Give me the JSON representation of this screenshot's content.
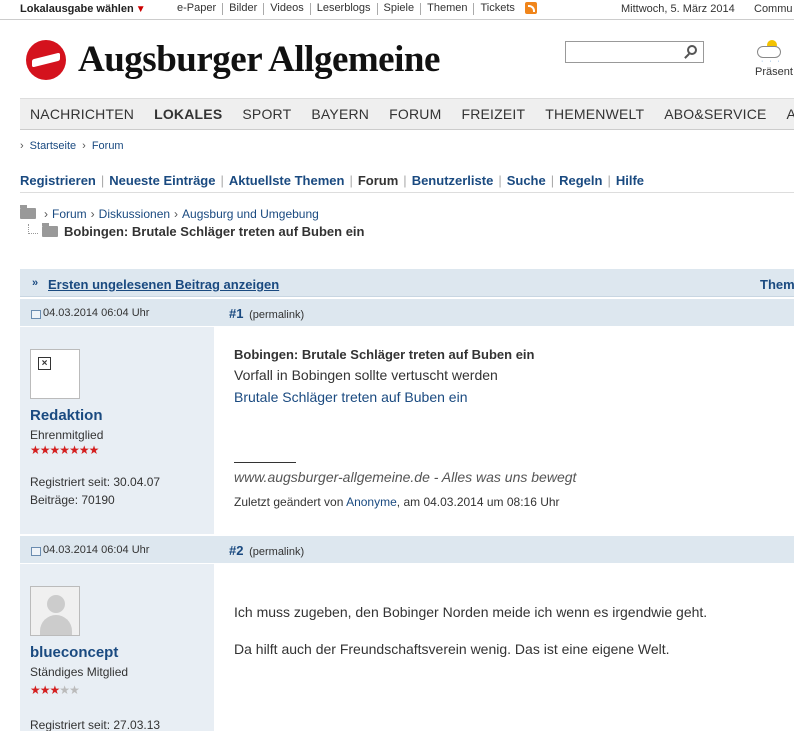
{
  "topbar": {
    "lokal": "Lokalausgabe wählen",
    "links": [
      "e-Paper",
      "Bilder",
      "Videos",
      "Leserblogs",
      "Spiele",
      "Themen",
      "Tickets"
    ],
    "date": "Mittwoch, 5. März 2014",
    "community": "Commu"
  },
  "header": {
    "logo_text": "Augsburger Allgemeine",
    "search_placeholder": "",
    "weather_label": "Präsent"
  },
  "mainnav": [
    "NACHRICHTEN",
    "LOKALES",
    "SPORT",
    "BAYERN",
    "FORUM",
    "FREIZEIT",
    "THEMENWELT",
    "ABO&SERVICE",
    "AN"
  ],
  "mainnav_active": "LOKALES",
  "breadcrumb": {
    "home": "Startseite",
    "forum": "Forum"
  },
  "forumnav": [
    "Registrieren",
    "Neueste Einträge",
    "Aktuellste Themen",
    "Forum",
    "Benutzerliste",
    "Suche",
    "Regeln",
    "Hilfe"
  ],
  "forumnav_current": "Forum",
  "folder_path": [
    "Forum",
    "Diskussionen",
    "Augsburg und Umgebung"
  ],
  "thread_title": "Bobingen: Brutale Schläger treten auf Buben ein",
  "unread": {
    "label": "Ersten ungelesenen Beitrag anzeigen",
    "right": "Them"
  },
  "posts": [
    {
      "date": "04.03.2014 06:04 Uhr",
      "number": "#1",
      "permalink": "(permalink)",
      "user": {
        "name": "Redaktion",
        "rank": "Ehrenmitglied",
        "stars_on": 7,
        "stars_total": 7,
        "registered": "Registriert seit: 30.04.07",
        "posts": "Beiträge: 70190"
      },
      "title": "Bobingen: Brutale Schläger treten auf Buben ein",
      "text": "Vorfall in Bobingen sollte vertuscht werden",
      "link": "Brutale Schläger treten auf Buben ein",
      "signature": "www.augsburger-allgemeine.de - Alles was uns bewegt",
      "edited_prefix": "Zuletzt geändert von ",
      "edited_by": "Anonyme",
      "edited_suffix": ", am 04.03.2014 um 08:16 Uhr"
    },
    {
      "date": "04.03.2014 06:04 Uhr",
      "number": "#2",
      "permalink": "(permalink)",
      "user": {
        "name": "blueconcept",
        "rank": "Ständiges Mitglied",
        "stars_on": 3,
        "stars_total": 5,
        "registered": "Registriert seit: 27.03.13"
      },
      "paragraphs": [
        "Ich muss zugeben, den Bobinger Norden meide ich wenn es irgendwie geht.",
        "Da hilft auch der Freundschaftsverein wenig. Das ist eine eigene Welt."
      ]
    }
  ]
}
